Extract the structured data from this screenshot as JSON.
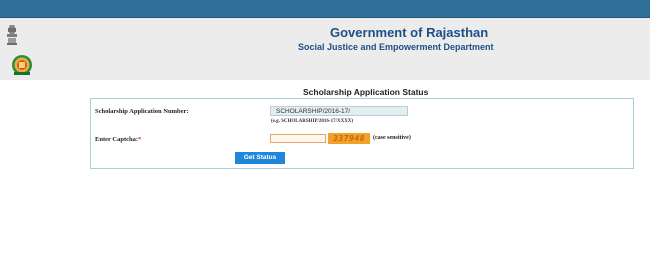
{
  "header": {
    "title": "Government of Rajasthan",
    "subtitle": "Social Justice and Empowerment Department"
  },
  "page": {
    "heading": "Scholarship Application Status"
  },
  "form": {
    "app_number_label": "Scholarship Application Number:",
    "app_number_value": "SCHOLARSHIP/2016-17/",
    "app_number_example": "(e.g. SCHOLARSHIP/2016-17/XXXX)",
    "captcha_label": "Enter Captcha:",
    "captcha_required_mark": "*",
    "captcha_value": "",
    "captcha_text": "337948",
    "captcha_note": "(case sensitive)",
    "submit_label": "Get Status"
  },
  "icons": {
    "emblem": "national-emblem-icon",
    "logo": "department-seal-icon"
  },
  "colors": {
    "top_bar": "#2f6f98",
    "title_text": "#1e4f86",
    "button": "#1f86d9",
    "captcha_bg": "#f4a02a",
    "required": "#d62020"
  }
}
